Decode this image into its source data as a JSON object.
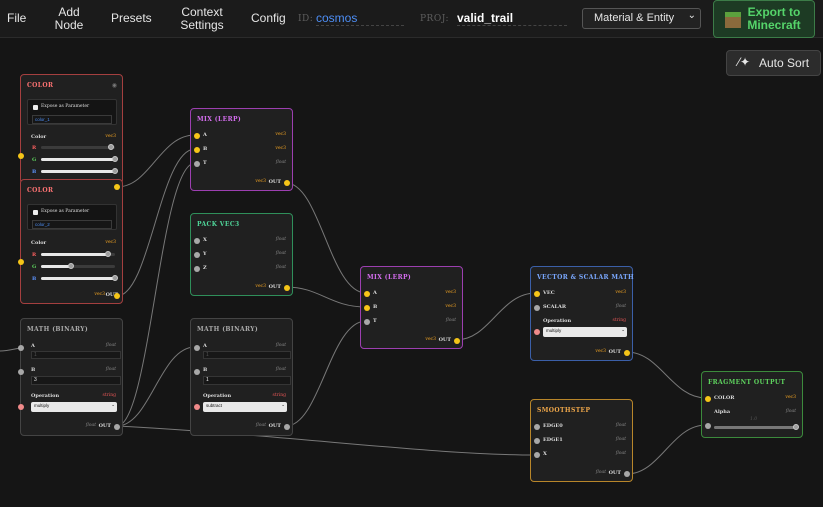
{
  "menu": {
    "file": "File",
    "add_node": "Add\nNode",
    "presets": "Presets",
    "context_settings": "Context\nSettings",
    "config": "Config"
  },
  "id_field": {
    "label": "ID:",
    "value": "cosmos"
  },
  "proj_field": {
    "label": "PROJ:",
    "value": "valid_trail"
  },
  "mode_select": {
    "value": "Material & Entity"
  },
  "export_button": {
    "label": "Export to\nMinecraft"
  },
  "auto_sort": {
    "label": "Auto Sort"
  },
  "colors": {
    "accent_green": "#55d46a",
    "id_blue": "#4d8ef5"
  },
  "nodes": {
    "color1": {
      "title": "COLOR",
      "expose": "Expose as Parameter",
      "name": "color_1",
      "section": "Color",
      "type": "vec3",
      "r": "R",
      "g": "G",
      "b": "B",
      "r_value": 0.95,
      "g_value": 1,
      "b_value": 1,
      "out": "OUT",
      "out_type": "vec3"
    },
    "color2": {
      "title": "COLOR",
      "expose": "Expose as Parameter",
      "name": "color_2",
      "section": "Color",
      "type": "vec3",
      "r": "R",
      "g": "G",
      "b": "B",
      "r_value": 0.9,
      "g_value": 0.4,
      "b_value": 1,
      "out": "OUT",
      "out_type": "vec3"
    },
    "math1": {
      "title": "MATH (BINARY)",
      "a": "A",
      "a_type": "float",
      "a_value": "1",
      "b": "B",
      "b_type": "float",
      "b_value": "3",
      "op_label": "Operation",
      "op_type": "string",
      "op_value": "multiply",
      "out": "OUT",
      "out_type": "float"
    },
    "mix1": {
      "title": "MIX (LERP)",
      "a": "A",
      "a_type": "vec3",
      "b": "B",
      "b_type": "vec3",
      "t": "T",
      "t_type": "float",
      "out": "OUT",
      "out_type": "vec3"
    },
    "pack": {
      "title": "PACK VEC3",
      "x": "X",
      "x_type": "float",
      "y": "Y",
      "y_type": "float",
      "z": "Z",
      "z_type": "float",
      "out": "OUT",
      "out_type": "vec3"
    },
    "math2": {
      "title": "MATH (BINARY)",
      "a": "A",
      "a_type": "float",
      "a_value": "1",
      "b": "B",
      "b_type": "float",
      "b_value": "1",
      "op_label": "Operation",
      "op_type": "string",
      "op_value": "subtract",
      "out": "OUT",
      "out_type": "float"
    },
    "mix2": {
      "title": "MIX (LERP)",
      "a": "A",
      "a_type": "vec3",
      "b": "B",
      "b_type": "vec3",
      "t": "T",
      "t_type": "float",
      "out": "OUT",
      "out_type": "vec3"
    },
    "vsm": {
      "title": "VECTOR & SCALAR MATH",
      "vec": "VEC",
      "vec_type": "vec3",
      "scalar": "SCALAR",
      "scalar_type": "float",
      "op_label": "Operation",
      "op_type": "string",
      "op_value": "multiply",
      "out": "OUT",
      "out_type": "vec3"
    },
    "smooth": {
      "title": "SMOOTHSTEP",
      "edge0": "EDGE0",
      "edge0_type": "float",
      "edge1": "EDGE1",
      "edge1_type": "float",
      "x": "X",
      "x_type": "float",
      "out": "OUT",
      "out_type": "float"
    },
    "frag": {
      "title": "FRAGMENT OUTPUT",
      "color": "COLOR",
      "color_type": "vec3",
      "alpha": "Alpha",
      "alpha_type": "float",
      "alpha_value_label": "1.0",
      "alpha_value": 1
    }
  }
}
